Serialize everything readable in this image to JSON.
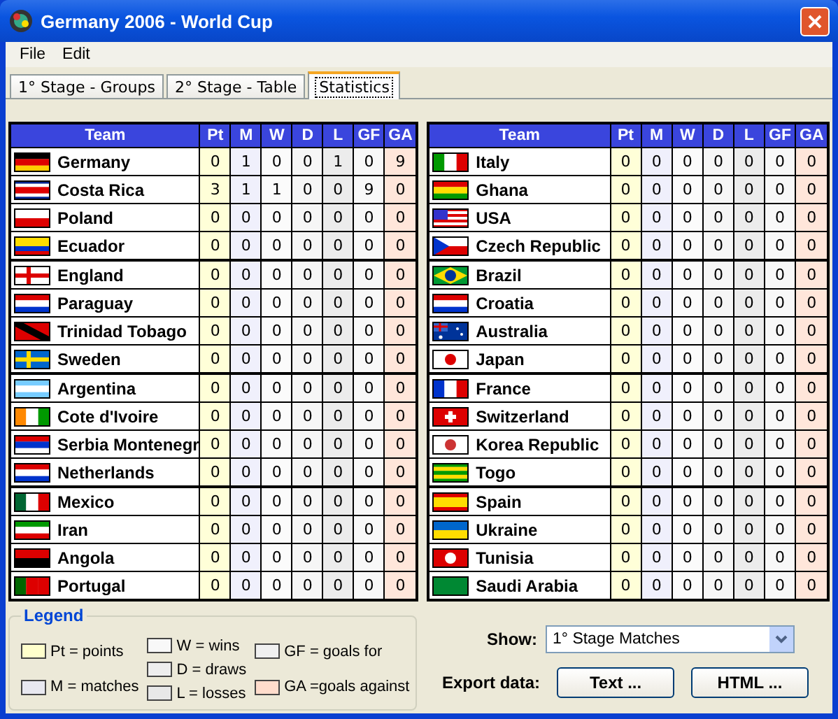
{
  "window": {
    "title": "Germany 2006 - World Cup"
  },
  "menu": [
    "File",
    "Edit"
  ],
  "tabs": [
    {
      "label": "1° Stage - Groups",
      "selected": false
    },
    {
      "label": "2° Stage - Table",
      "selected": false
    },
    {
      "label": "Statistics",
      "selected": true
    }
  ],
  "tables": [
    {
      "columns": [
        {
          "label": "Team"
        },
        {
          "label": "Pt",
          "color": "#ffffd8"
        },
        {
          "label": "M",
          "color": "#f0f0fc"
        },
        {
          "label": "W",
          "color": "#fbfbfb"
        },
        {
          "label": "D",
          "color": "#f6f6f6"
        },
        {
          "label": "L",
          "color": "#ececec"
        },
        {
          "label": "GF",
          "color": "#f8f8f8"
        },
        {
          "label": "GA",
          "color": "#ffe6da"
        }
      ],
      "groups": [
        [
          {
            "team": "Germany",
            "values": [
              "0",
              "1",
              "0",
              "0",
              "1",
              "0",
              "9"
            ]
          },
          {
            "team": "Costa Rica",
            "values": [
              "3",
              "1",
              "1",
              "0",
              "0",
              "9",
              "0"
            ]
          },
          {
            "team": "Poland",
            "values": [
              "0",
              "0",
              "0",
              "0",
              "0",
              "0",
              "0"
            ]
          },
          {
            "team": "Ecuador",
            "values": [
              "0",
              "0",
              "0",
              "0",
              "0",
              "0",
              "0"
            ]
          }
        ],
        [
          {
            "team": "England",
            "values": [
              "0",
              "0",
              "0",
              "0",
              "0",
              "0",
              "0"
            ]
          },
          {
            "team": "Paraguay",
            "values": [
              "0",
              "0",
              "0",
              "0",
              "0",
              "0",
              "0"
            ]
          },
          {
            "team": "Trinidad Tobago",
            "values": [
              "0",
              "0",
              "0",
              "0",
              "0",
              "0",
              "0"
            ]
          },
          {
            "team": "Sweden",
            "values": [
              "0",
              "0",
              "0",
              "0",
              "0",
              "0",
              "0"
            ]
          }
        ],
        [
          {
            "team": "Argentina",
            "values": [
              "0",
              "0",
              "0",
              "0",
              "0",
              "0",
              "0"
            ]
          },
          {
            "team": "Cote d'Ivoire",
            "values": [
              "0",
              "0",
              "0",
              "0",
              "0",
              "0",
              "0"
            ]
          },
          {
            "team": "Serbia Montenegr",
            "values": [
              "0",
              "0",
              "0",
              "0",
              "0",
              "0",
              "0"
            ]
          },
          {
            "team": "Netherlands",
            "values": [
              "0",
              "0",
              "0",
              "0",
              "0",
              "0",
              "0"
            ]
          }
        ],
        [
          {
            "team": "Mexico",
            "values": [
              "0",
              "0",
              "0",
              "0",
              "0",
              "0",
              "0"
            ]
          },
          {
            "team": "Iran",
            "values": [
              "0",
              "0",
              "0",
              "0",
              "0",
              "0",
              "0"
            ]
          },
          {
            "team": "Angola",
            "values": [
              "0",
              "0",
              "0",
              "0",
              "0",
              "0",
              "0"
            ]
          },
          {
            "team": "Portugal",
            "values": [
              "0",
              "0",
              "0",
              "0",
              "0",
              "0",
              "0"
            ]
          }
        ]
      ]
    },
    {
      "columns": [
        {
          "label": "Team"
        },
        {
          "label": "Pt",
          "color": "#ffffd8"
        },
        {
          "label": "M",
          "color": "#f0f0fc"
        },
        {
          "label": "W",
          "color": "#fbfbfb"
        },
        {
          "label": "D",
          "color": "#f6f6f6"
        },
        {
          "label": "L",
          "color": "#ececec"
        },
        {
          "label": "GF",
          "color": "#f8f8f8"
        },
        {
          "label": "GA",
          "color": "#ffe6da"
        }
      ],
      "groups": [
        [
          {
            "team": "Italy",
            "values": [
              "0",
              "0",
              "0",
              "0",
              "0",
              "0",
              "0"
            ]
          },
          {
            "team": "Ghana",
            "values": [
              "0",
              "0",
              "0",
              "0",
              "0",
              "0",
              "0"
            ]
          },
          {
            "team": "USA",
            "values": [
              "0",
              "0",
              "0",
              "0",
              "0",
              "0",
              "0"
            ]
          },
          {
            "team": "Czech Republic",
            "values": [
              "0",
              "0",
              "0",
              "0",
              "0",
              "0",
              "0"
            ]
          }
        ],
        [
          {
            "team": "Brazil",
            "values": [
              "0",
              "0",
              "0",
              "0",
              "0",
              "0",
              "0"
            ]
          },
          {
            "team": "Croatia",
            "values": [
              "0",
              "0",
              "0",
              "0",
              "0",
              "0",
              "0"
            ]
          },
          {
            "team": "Australia",
            "values": [
              "0",
              "0",
              "0",
              "0",
              "0",
              "0",
              "0"
            ]
          },
          {
            "team": "Japan",
            "values": [
              "0",
              "0",
              "0",
              "0",
              "0",
              "0",
              "0"
            ]
          }
        ],
        [
          {
            "team": "France",
            "values": [
              "0",
              "0",
              "0",
              "0",
              "0",
              "0",
              "0"
            ]
          },
          {
            "team": "Switzerland",
            "values": [
              "0",
              "0",
              "0",
              "0",
              "0",
              "0",
              "0"
            ]
          },
          {
            "team": "Korea Republic",
            "values": [
              "0",
              "0",
              "0",
              "0",
              "0",
              "0",
              "0"
            ]
          },
          {
            "team": "Togo",
            "values": [
              "0",
              "0",
              "0",
              "0",
              "0",
              "0",
              "0"
            ]
          }
        ],
        [
          {
            "team": "Spain",
            "values": [
              "0",
              "0",
              "0",
              "0",
              "0",
              "0",
              "0"
            ]
          },
          {
            "team": "Ukraine",
            "values": [
              "0",
              "0",
              "0",
              "0",
              "0",
              "0",
              "0"
            ]
          },
          {
            "team": "Tunisia",
            "values": [
              "0",
              "0",
              "0",
              "0",
              "0",
              "0",
              "0"
            ]
          },
          {
            "team": "Saudi Arabia",
            "values": [
              "0",
              "0",
              "0",
              "0",
              "0",
              "0",
              "0"
            ]
          }
        ]
      ]
    }
  ],
  "legend": {
    "title": "Legend",
    "columns": [
      [
        {
          "text": "Pt = points",
          "color": "#ffffcc"
        },
        {
          "text": "M = matches",
          "color": "#e8e8f0"
        }
      ],
      [
        {
          "text": "W = wins",
          "color": "#f8f8f8"
        },
        {
          "text": "D = draws",
          "color": "#eeeeee"
        },
        {
          "text": "L = losses",
          "color": "#e8e8e8"
        }
      ],
      [
        {
          "text": "GF = goals for",
          "color": "#f0f0f0"
        },
        {
          "text": "GA =goals against",
          "color": "#ffdccc"
        }
      ]
    ]
  },
  "show": {
    "label": "Show:",
    "value": "1° Stage Matches"
  },
  "export": {
    "label": "Export data:",
    "buttons": [
      "Text ...",
      "HTML ..."
    ]
  }
}
